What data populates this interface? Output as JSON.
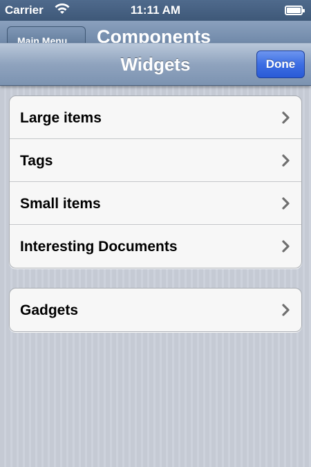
{
  "status_bar": {
    "carrier": "Carrier",
    "time": "11:11 AM"
  },
  "background_nav": {
    "back_label": "Main Menu",
    "title": "Components"
  },
  "navbar": {
    "title": "Widgets",
    "done_label": "Done"
  },
  "groups": [
    {
      "items": [
        {
          "label": "Large items",
          "icon": "chevron-right-icon"
        },
        {
          "label": "Tags",
          "icon": "chevron-right-icon"
        },
        {
          "label": "Small items",
          "icon": "chevron-right-icon"
        },
        {
          "label": "Interesting Documents",
          "icon": "chevron-right-icon"
        }
      ]
    },
    {
      "items": [
        {
          "label": "Gadgets",
          "icon": "chevron-right-icon"
        }
      ]
    }
  ],
  "colors": {
    "done_button": "#3c6ee3",
    "navbar": "#8fa3be",
    "background": "#c7ccd6"
  }
}
